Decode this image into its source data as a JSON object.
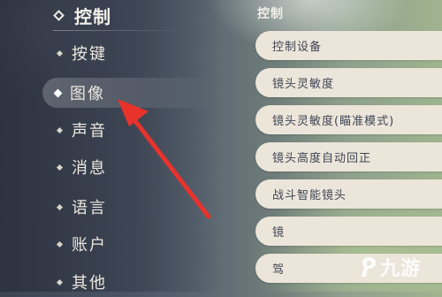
{
  "sidebar": {
    "category": "控制",
    "items": [
      {
        "label": "按键",
        "active": false
      },
      {
        "label": "图像",
        "active": true
      },
      {
        "label": "声音",
        "active": false
      },
      {
        "label": "消息",
        "active": false
      },
      {
        "label": "语言",
        "active": false
      },
      {
        "label": "账户",
        "active": false
      },
      {
        "label": "其他",
        "active": false
      }
    ]
  },
  "content": {
    "section_title": "控制",
    "settings": [
      {
        "label": "控制设备"
      },
      {
        "label": "镜头灵敏度"
      },
      {
        "label": "镜头灵敏度(瞄准模式)"
      },
      {
        "label": "镜头高度自动回正"
      },
      {
        "label": "战斗智能镜头"
      },
      {
        "label": "镜"
      },
      {
        "label": "驾"
      }
    ]
  },
  "annotation": {
    "arrow_color": "#e8332c",
    "arrow_icon": "red-arrow-icon"
  },
  "watermark": {
    "text": "九游",
    "icon": "9game-logo-icon"
  },
  "colors": {
    "row_bg": "#ece5d9",
    "row_text": "#3f4656",
    "menu_text": "#ece8df"
  }
}
